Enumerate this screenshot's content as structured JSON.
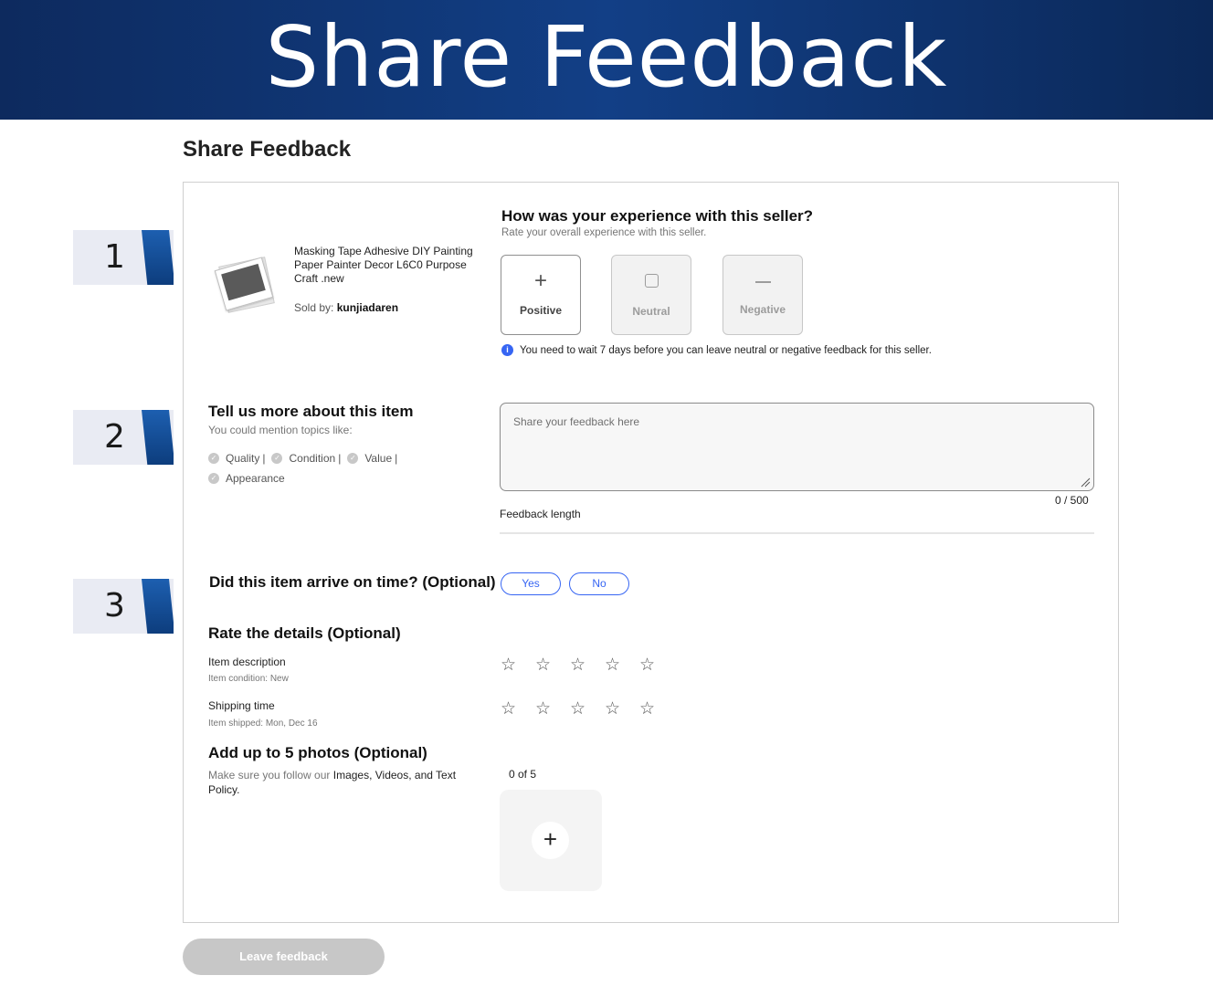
{
  "banner": {
    "title": "Share Feedback"
  },
  "page": {
    "title": "Share Feedback"
  },
  "steps": [
    "1",
    "2",
    "3"
  ],
  "item": {
    "title": "Masking Tape Adhesive DIY Painting Paper Painter Decor L6C0 Purpose Craft .new",
    "sold_by_label": "Sold by:",
    "seller": "kunjiadaren"
  },
  "experience": {
    "question": "How was your experience with this seller?",
    "subtitle": "Rate your overall experience with this seller.",
    "options": [
      {
        "label": "Positive",
        "icon": "plus-icon"
      },
      {
        "label": "Neutral",
        "icon": "square-icon"
      },
      {
        "label": "Negative",
        "icon": "minus-icon"
      }
    ],
    "notice": "You need to wait 7 days before you can leave neutral or negative feedback for this seller."
  },
  "details": {
    "title": "Tell us more about this item",
    "subtitle": "You could mention topics like:",
    "topics": [
      "Quality",
      "Condition",
      "Value",
      "Appearance"
    ],
    "placeholder": "Share your feedback here",
    "counter": "0 / 500",
    "length_label": "Feedback length"
  },
  "arrival": {
    "question": "Did this item arrive on time? (Optional)",
    "yes": "Yes",
    "no": "No"
  },
  "rate_details": {
    "title": "Rate the details (Optional)",
    "rows": [
      {
        "label": "Item description",
        "sub": "Item condition: New"
      },
      {
        "label": "Shipping time",
        "sub": "Item shipped: Mon, Dec 16"
      }
    ],
    "star_glyph": "☆"
  },
  "photos": {
    "title": "Add up to 5 photos (Optional)",
    "sub_prefix": "Make sure you follow our ",
    "policy": "Images, Videos, and Text Policy.",
    "count": "0 of 5"
  },
  "submit": {
    "label": "Leave feedback"
  },
  "colors": {
    "banner": "#123f86",
    "accent": "#3665f3",
    "disabled": "#c7c7c7"
  }
}
